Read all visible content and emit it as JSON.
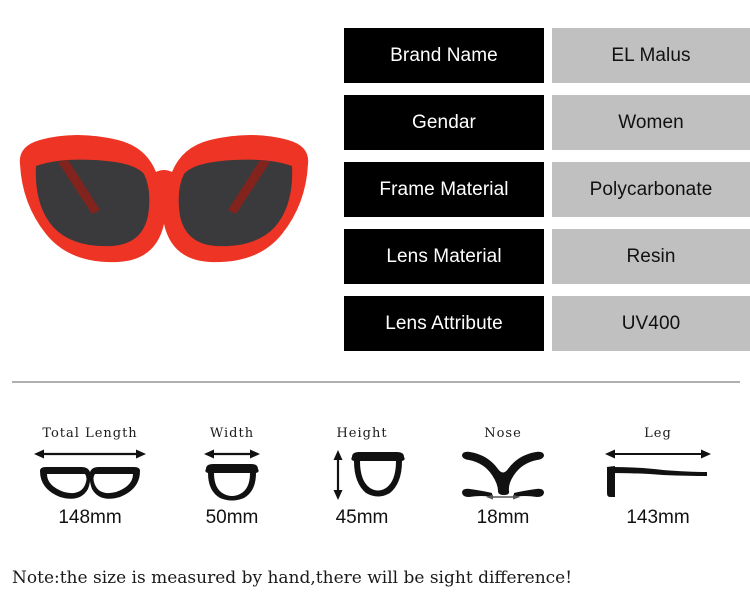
{
  "colors": {
    "frame_red": "#ee3424",
    "lens_dark": "#3a3a3c",
    "key_cell_bg": "#000000",
    "key_cell_text": "#ffffff",
    "value_cell_bg": "#c0c0c0",
    "value_cell_text": "#111111",
    "divider": "#b0b0b0",
    "page_bg": "#ffffff"
  },
  "product_image": {
    "alt": "red cat-eye sunglasses front view",
    "icon": "sunglasses-icon"
  },
  "spec_table": {
    "rows": [
      {
        "key": "Brand Name",
        "value": "EL Malus"
      },
      {
        "key": "Gendar",
        "value": "Women"
      },
      {
        "key": "Frame Material",
        "value": "Polycarbonate"
      },
      {
        "key": "Lens Material",
        "value": "Resin"
      },
      {
        "key": "Lens Attribute",
        "value": "UV400"
      }
    ]
  },
  "measurements": {
    "items": [
      {
        "label": "Total Length",
        "value": "148mm",
        "icon": "eyeglasses-front-icon"
      },
      {
        "label": "Width",
        "value": "50mm",
        "icon": "lens-width-icon"
      },
      {
        "label": "Height",
        "value": "45mm",
        "icon": "lens-height-icon"
      },
      {
        "label": "Nose",
        "value": "18mm",
        "icon": "nose-bridge-icon"
      },
      {
        "label": "Leg",
        "value": "143mm",
        "icon": "temple-arm-icon"
      }
    ]
  },
  "note": {
    "text": "Note:the size is measured by hand,there will be sight difference!"
  }
}
